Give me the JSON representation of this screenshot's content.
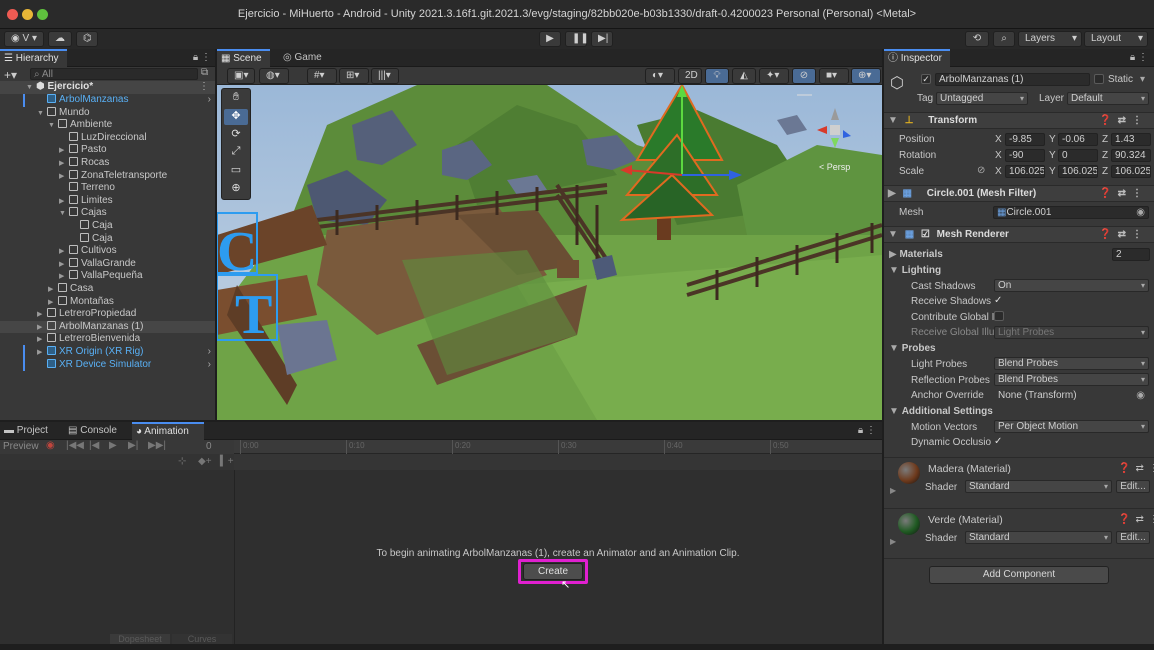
{
  "window": {
    "title": "Ejercicio - MiHuerto - Android - Unity 2021.3.16f1.git.2021.3/evg/staging/82bb020e-b03b1330/draft-0.4200023 Personal (Personal) <Metal>"
  },
  "toolbar": {
    "account_label": "V",
    "layers_label": "Layers",
    "layout_label": "Layout"
  },
  "hierarchy": {
    "tab": "Hierarchy",
    "search_placeholder": "All",
    "scene_name": "Ejercicio*",
    "items": [
      {
        "label": "ArbolManzanas",
        "depth": 1,
        "blue": true,
        "arrow": false
      },
      {
        "label": "Mundo",
        "depth": 1,
        "blue": false,
        "arrow": "open"
      },
      {
        "label": "Ambiente",
        "depth": 2,
        "blue": false,
        "arrow": "open"
      },
      {
        "label": "LuzDireccional",
        "depth": 3,
        "blue": false,
        "arrow": false
      },
      {
        "label": "Pasto",
        "depth": 3,
        "blue": false,
        "arrow": "closed"
      },
      {
        "label": "Rocas",
        "depth": 3,
        "blue": false,
        "arrow": "closed"
      },
      {
        "label": "ZonaTeletransporte",
        "depth": 3,
        "blue": false,
        "arrow": "closed"
      },
      {
        "label": "Terreno",
        "depth": 3,
        "blue": false,
        "arrow": false
      },
      {
        "label": "Limites",
        "depth": 3,
        "blue": false,
        "arrow": "closed"
      },
      {
        "label": "Cajas",
        "depth": 3,
        "blue": false,
        "arrow": "open"
      },
      {
        "label": "Caja",
        "depth": 4,
        "blue": false,
        "arrow": false
      },
      {
        "label": "Caja",
        "depth": 4,
        "blue": false,
        "arrow": false
      },
      {
        "label": "Cultivos",
        "depth": 3,
        "blue": false,
        "arrow": "closed"
      },
      {
        "label": "VallaGrande",
        "depth": 3,
        "blue": false,
        "arrow": "closed"
      },
      {
        "label": "VallaPequeña",
        "depth": 3,
        "blue": false,
        "arrow": "closed"
      },
      {
        "label": "Casa",
        "depth": 2,
        "blue": false,
        "arrow": "closed"
      },
      {
        "label": "Montañas",
        "depth": 2,
        "blue": false,
        "arrow": "closed"
      },
      {
        "label": "LetreroPropiedad",
        "depth": 1,
        "blue": false,
        "arrow": "closed"
      },
      {
        "label": "ArbolManzanas (1)",
        "depth": 1,
        "blue": false,
        "arrow": "closed",
        "selected": true
      },
      {
        "label": "LetreroBienvenida",
        "depth": 1,
        "blue": false,
        "arrow": "closed"
      },
      {
        "label": "XR Origin (XR Rig)",
        "depth": 1,
        "blue": true,
        "arrow": "closed"
      },
      {
        "label": "XR Device Simulator",
        "depth": 1,
        "blue": true,
        "arrow": false
      }
    ]
  },
  "scene": {
    "tabs": [
      "Scene",
      "Game"
    ],
    "mode_2d": "2D",
    "persp_label": "< Persp"
  },
  "bottom": {
    "tabs": [
      "Project",
      "Console",
      "Animation"
    ],
    "preview_label": "Preview",
    "frame_value": "0",
    "timeline_ticks": [
      "0:00",
      "0:10",
      "0:20",
      "0:30",
      "0:40",
      "0:50"
    ],
    "message": "To begin animating ArbolManzanas (1), create an Animator and an Animation Clip.",
    "create_label": "Create",
    "footer_tabs": [
      "Dopesheet",
      "Curves"
    ]
  },
  "inspector": {
    "tab": "Inspector",
    "object_name": "ArbolManzanas (1)",
    "static_label": "Static",
    "tag_label": "Tag",
    "tag_value": "Untagged",
    "layer_label": "Layer",
    "layer_value": "Default",
    "transform": {
      "title": "Transform",
      "position_label": "Position",
      "rotation_label": "Rotation",
      "scale_label": "Scale",
      "position": {
        "x": "-9.85",
        "y": "-0.06",
        "z": "1.43"
      },
      "rotation": {
        "x": "-90",
        "y": "0",
        "z": "90.324"
      },
      "scale": {
        "x": "106.025",
        "y": "106.025",
        "z": "106.025"
      }
    },
    "mesh_filter": {
      "title": "Circle.001 (Mesh Filter)",
      "mesh_label": "Mesh",
      "mesh_value": "Circle.001"
    },
    "mesh_renderer": {
      "title": "Mesh Renderer",
      "materials_label": "Materials",
      "materials_count": "2",
      "lighting_label": "Lighting",
      "cast_shadows_label": "Cast Shadows",
      "cast_shadows_value": "On",
      "receive_shadows_label": "Receive Shadows",
      "contribute_gi_label": "Contribute Global I",
      "receive_gi_label": "Receive Global Illu",
      "receive_gi_value": "Light Probes",
      "probes_label": "Probes",
      "light_probes_label": "Light Probes",
      "light_probes_value": "Blend Probes",
      "reflection_probes_label": "Reflection Probes",
      "reflection_probes_value": "Blend Probes",
      "anchor_override_label": "Anchor Override",
      "anchor_override_value": "None (Transform)",
      "additional_label": "Additional Settings",
      "motion_vectors_label": "Motion Vectors",
      "motion_vectors_value": "Per Object Motion",
      "dynamic_occlusion_label": "Dynamic Occlusio"
    },
    "materials": [
      {
        "name": "Madera (Material)",
        "shader_label": "Shader",
        "shader_value": "Standard",
        "edit_label": "Edit...",
        "color": "#6e3a1c"
      },
      {
        "name": "Verde (Material)",
        "shader_label": "Shader",
        "shader_value": "Standard",
        "edit_label": "Edit...",
        "color": "#1f5a22"
      }
    ],
    "add_component_label": "Add Component"
  },
  "colors": {
    "accent_blue": "#4a8df0",
    "highlight_magenta": "#e020d0",
    "prefab_blue": "#59b0f5"
  }
}
